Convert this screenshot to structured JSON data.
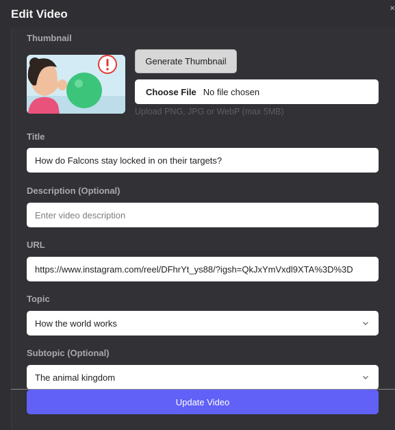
{
  "modal": {
    "title": "Edit Video",
    "close_glyph": "×"
  },
  "thumbnail": {
    "label": "Thumbnail",
    "image_icon": "thumbnail-image",
    "generate_label": "Generate Thumbnail",
    "choose_file_label": "Choose File",
    "file_status": "No file chosen",
    "hint": "Upload PNG, JPG or WebP (max 5MB)"
  },
  "title_field": {
    "label": "Title",
    "value": "How do Falcons stay locked in on their targets?"
  },
  "description_field": {
    "label": "Description (Optional)",
    "value": "",
    "placeholder": "Enter video description"
  },
  "url_field": {
    "label": "URL",
    "value": "https://www.instagram.com/reel/DFhrYt_ys88/?igsh=QkJxYmVxdl9XTA%3D%3D"
  },
  "topic_field": {
    "label": "Topic",
    "selected": "How the world works"
  },
  "subtopic_field": {
    "label": "Subtopic (Optional)",
    "selected": "The animal kingdom"
  },
  "submit": {
    "label": "Update Video"
  },
  "colors": {
    "accent": "#6161f7",
    "background": "#2e2e33",
    "field": "#ffffff"
  }
}
